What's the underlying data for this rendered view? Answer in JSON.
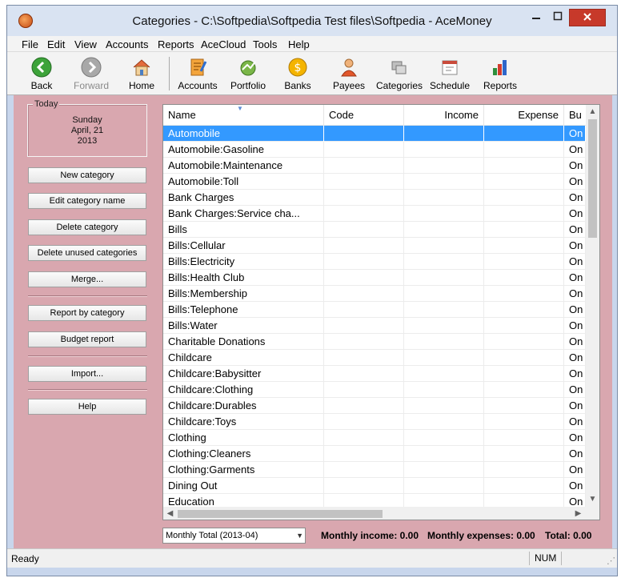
{
  "window": {
    "title": "Categories - C:\\Softpedia\\Softpedia Test files\\Softpedia - AceMoney"
  },
  "menu": [
    "File",
    "Edit",
    "View",
    "Accounts",
    "Reports",
    "AceCloud",
    "Tools",
    "Help"
  ],
  "toolbar": {
    "back": "Back",
    "forward": "Forward",
    "home": "Home",
    "accounts": "Accounts",
    "portfolio": "Portfolio",
    "banks": "Banks",
    "payees": "Payees",
    "categories": "Categories",
    "schedule": "Schedule",
    "reports": "Reports"
  },
  "today": {
    "legend": "Today",
    "weekday": "Sunday",
    "date": "April, 21",
    "year": "2013"
  },
  "sidebar": {
    "new_category": "New category",
    "edit_category_name": "Edit category name",
    "delete_category": "Delete category",
    "delete_unused": "Delete unused categories",
    "merge": "Merge...",
    "report_by_category": "Report by category",
    "budget_report": "Budget report",
    "import": "Import...",
    "help": "Help"
  },
  "list": {
    "columns": {
      "name": "Name",
      "code": "Code",
      "income": "Income",
      "expense": "Expense",
      "budget": "Bu"
    },
    "rows": [
      {
        "name": "Automobile",
        "bud": "On"
      },
      {
        "name": "Automobile:Gasoline",
        "bud": "On"
      },
      {
        "name": "Automobile:Maintenance",
        "bud": "On"
      },
      {
        "name": "Automobile:Toll",
        "bud": "On"
      },
      {
        "name": "Bank Charges",
        "bud": "On"
      },
      {
        "name": "Bank Charges:Service cha...",
        "bud": "On"
      },
      {
        "name": "Bills",
        "bud": "On"
      },
      {
        "name": "Bills:Cellular",
        "bud": "On"
      },
      {
        "name": "Bills:Electricity",
        "bud": "On"
      },
      {
        "name": "Bills:Health Club",
        "bud": "On"
      },
      {
        "name": "Bills:Membership",
        "bud": "On"
      },
      {
        "name": "Bills:Telephone",
        "bud": "On"
      },
      {
        "name": "Bills:Water",
        "bud": "On"
      },
      {
        "name": "Charitable Donations",
        "bud": "On"
      },
      {
        "name": "Childcare",
        "bud": "On"
      },
      {
        "name": "Childcare:Babysitter",
        "bud": "On"
      },
      {
        "name": "Childcare:Clothing",
        "bud": "On"
      },
      {
        "name": "Childcare:Durables",
        "bud": "On"
      },
      {
        "name": "Childcare:Toys",
        "bud": "On"
      },
      {
        "name": "Clothing",
        "bud": "On"
      },
      {
        "name": "Clothing:Cleaners",
        "bud": "On"
      },
      {
        "name": "Clothing:Garments",
        "bud": "On"
      },
      {
        "name": "Dining Out",
        "bud": "On"
      },
      {
        "name": "Education",
        "bud": "On"
      }
    ]
  },
  "footer": {
    "period": "Monthly Total (2013-04)",
    "monthly_income": "Monthly income: 0.00",
    "monthly_expenses": "Monthly expenses: 0.00",
    "total": "Total: 0.00"
  },
  "status": {
    "text": "Ready",
    "num": "NUM"
  },
  "colors": {
    "panel": "#d9a7af",
    "selection": "#3399ff",
    "close": "#c7392a"
  }
}
